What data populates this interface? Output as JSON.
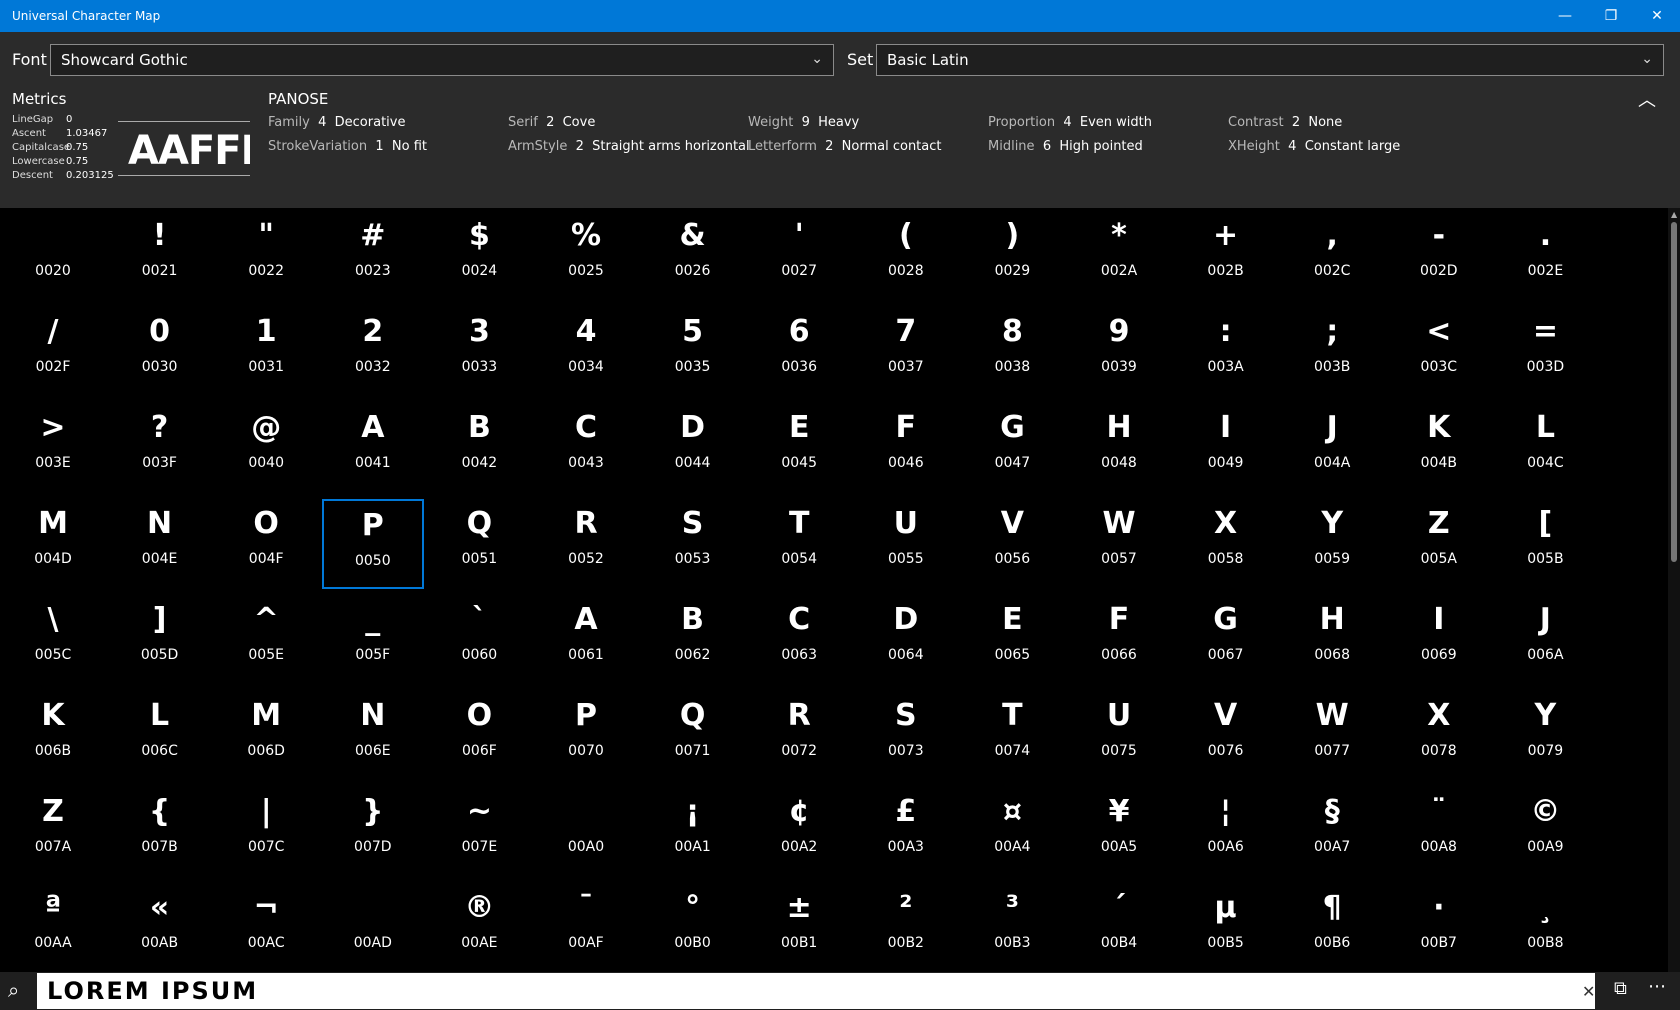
{
  "window": {
    "title": "Universal Character Map",
    "minimize_glyph": "—",
    "maximize_glyph": "❐",
    "close_glyph": "✕"
  },
  "font_bar": {
    "font_label": "Font",
    "font_value": "Showcard Gothic",
    "set_label": "Set",
    "set_value": "Basic Latin",
    "chevron": "⌄"
  },
  "metrics": {
    "title": "Metrics",
    "rows": [
      {
        "key": "LineGap",
        "value": "0"
      },
      {
        "key": "Ascent",
        "value": "1.03467"
      },
      {
        "key": "Capitalcase",
        "value": "0.75"
      },
      {
        "key": "Lowercase",
        "value": "0.75"
      },
      {
        "key": "Descent",
        "value": "0.203125"
      }
    ],
    "preview_text": "AAFFI"
  },
  "panose": {
    "title": "PANOSE",
    "items": [
      {
        "key": "Family",
        "num": "4",
        "value": "Decorative"
      },
      {
        "key": "Serif",
        "num": "2",
        "value": "Cove"
      },
      {
        "key": "Weight",
        "num": "9",
        "value": "Heavy"
      },
      {
        "key": "Proportion",
        "num": "4",
        "value": "Even width"
      },
      {
        "key": "Contrast",
        "num": "2",
        "value": "None"
      },
      {
        "key": "StrokeVariation",
        "num": "1",
        "value": "No fit"
      },
      {
        "key": "ArmStyle",
        "num": "2",
        "value": "Straight arms horizontal"
      },
      {
        "key": "Letterform",
        "num": "2",
        "value": "Normal contact"
      },
      {
        "key": "Midline",
        "num": "6",
        "value": "High pointed"
      },
      {
        "key": "XHeight",
        "num": "4",
        "value": "Constant large"
      }
    ],
    "collapse_glyph": "︿"
  },
  "grid": {
    "selected_code": "0050",
    "cells": [
      {
        "glyph": " ",
        "code": "0020"
      },
      {
        "glyph": "!",
        "code": "0021"
      },
      {
        "glyph": "\"",
        "code": "0022"
      },
      {
        "glyph": "#",
        "code": "0023"
      },
      {
        "glyph": "$",
        "code": "0024"
      },
      {
        "glyph": "%",
        "code": "0025"
      },
      {
        "glyph": "&",
        "code": "0026"
      },
      {
        "glyph": "'",
        "code": "0027"
      },
      {
        "glyph": "(",
        "code": "0028"
      },
      {
        "glyph": ")",
        "code": "0029"
      },
      {
        "glyph": "*",
        "code": "002A"
      },
      {
        "glyph": "+",
        "code": "002B"
      },
      {
        "glyph": ",",
        "code": "002C"
      },
      {
        "glyph": "-",
        "code": "002D"
      },
      {
        "glyph": ".",
        "code": "002E"
      },
      {
        "glyph": "/",
        "code": "002F"
      },
      {
        "glyph": "0",
        "code": "0030"
      },
      {
        "glyph": "1",
        "code": "0031"
      },
      {
        "glyph": "2",
        "code": "0032"
      },
      {
        "glyph": "3",
        "code": "0033"
      },
      {
        "glyph": "4",
        "code": "0034"
      },
      {
        "glyph": "5",
        "code": "0035"
      },
      {
        "glyph": "6",
        "code": "0036"
      },
      {
        "glyph": "7",
        "code": "0037"
      },
      {
        "glyph": "8",
        "code": "0038"
      },
      {
        "glyph": "9",
        "code": "0039"
      },
      {
        "glyph": ":",
        "code": "003A"
      },
      {
        "glyph": ";",
        "code": "003B"
      },
      {
        "glyph": "<",
        "code": "003C"
      },
      {
        "glyph": "=",
        "code": "003D"
      },
      {
        "glyph": ">",
        "code": "003E"
      },
      {
        "glyph": "?",
        "code": "003F"
      },
      {
        "glyph": "@",
        "code": "0040"
      },
      {
        "glyph": "A",
        "code": "0041"
      },
      {
        "glyph": "B",
        "code": "0042"
      },
      {
        "glyph": "C",
        "code": "0043"
      },
      {
        "glyph": "D",
        "code": "0044"
      },
      {
        "glyph": "E",
        "code": "0045"
      },
      {
        "glyph": "F",
        "code": "0046"
      },
      {
        "glyph": "G",
        "code": "0047"
      },
      {
        "glyph": "H",
        "code": "0048"
      },
      {
        "glyph": "I",
        "code": "0049"
      },
      {
        "glyph": "J",
        "code": "004A"
      },
      {
        "glyph": "K",
        "code": "004B"
      },
      {
        "glyph": "L",
        "code": "004C"
      },
      {
        "glyph": "M",
        "code": "004D"
      },
      {
        "glyph": "N",
        "code": "004E"
      },
      {
        "glyph": "O",
        "code": "004F"
      },
      {
        "glyph": "P",
        "code": "0050"
      },
      {
        "glyph": "Q",
        "code": "0051"
      },
      {
        "glyph": "R",
        "code": "0052"
      },
      {
        "glyph": "S",
        "code": "0053"
      },
      {
        "glyph": "T",
        "code": "0054"
      },
      {
        "glyph": "U",
        "code": "0055"
      },
      {
        "glyph": "V",
        "code": "0056"
      },
      {
        "glyph": "W",
        "code": "0057"
      },
      {
        "glyph": "X",
        "code": "0058"
      },
      {
        "glyph": "Y",
        "code": "0059"
      },
      {
        "glyph": "Z",
        "code": "005A"
      },
      {
        "glyph": "[",
        "code": "005B"
      },
      {
        "glyph": "\\",
        "code": "005C"
      },
      {
        "glyph": "]",
        "code": "005D"
      },
      {
        "glyph": "^",
        "code": "005E"
      },
      {
        "glyph": "_",
        "code": "005F"
      },
      {
        "glyph": "`",
        "code": "0060"
      },
      {
        "glyph": "A",
        "code": "0061"
      },
      {
        "glyph": "B",
        "code": "0062"
      },
      {
        "glyph": "C",
        "code": "0063"
      },
      {
        "glyph": "D",
        "code": "0064"
      },
      {
        "glyph": "E",
        "code": "0065"
      },
      {
        "glyph": "F",
        "code": "0066"
      },
      {
        "glyph": "G",
        "code": "0067"
      },
      {
        "glyph": "H",
        "code": "0068"
      },
      {
        "glyph": "I",
        "code": "0069"
      },
      {
        "glyph": "J",
        "code": "006A"
      },
      {
        "glyph": "K",
        "code": "006B"
      },
      {
        "glyph": "L",
        "code": "006C"
      },
      {
        "glyph": "M",
        "code": "006D"
      },
      {
        "glyph": "N",
        "code": "006E"
      },
      {
        "glyph": "O",
        "code": "006F"
      },
      {
        "glyph": "P",
        "code": "0070"
      },
      {
        "glyph": "Q",
        "code": "0071"
      },
      {
        "glyph": "R",
        "code": "0072"
      },
      {
        "glyph": "S",
        "code": "0073"
      },
      {
        "glyph": "T",
        "code": "0074"
      },
      {
        "glyph": "U",
        "code": "0075"
      },
      {
        "glyph": "V",
        "code": "0076"
      },
      {
        "glyph": "W",
        "code": "0077"
      },
      {
        "glyph": "X",
        "code": "0078"
      },
      {
        "glyph": "Y",
        "code": "0079"
      },
      {
        "glyph": "Z",
        "code": "007A"
      },
      {
        "glyph": "{",
        "code": "007B"
      },
      {
        "glyph": "|",
        "code": "007C"
      },
      {
        "glyph": "}",
        "code": "007D"
      },
      {
        "glyph": "~",
        "code": "007E"
      },
      {
        "glyph": " ",
        "code": "00A0"
      },
      {
        "glyph": "¡",
        "code": "00A1"
      },
      {
        "glyph": "¢",
        "code": "00A2"
      },
      {
        "glyph": "£",
        "code": "00A3"
      },
      {
        "glyph": "¤",
        "code": "00A4"
      },
      {
        "glyph": "¥",
        "code": "00A5"
      },
      {
        "glyph": "¦",
        "code": "00A6"
      },
      {
        "glyph": "§",
        "code": "00A7"
      },
      {
        "glyph": "¨",
        "code": "00A8"
      },
      {
        "glyph": "©",
        "code": "00A9"
      },
      {
        "glyph": "ª",
        "code": "00AA"
      },
      {
        "glyph": "«",
        "code": "00AB"
      },
      {
        "glyph": "¬",
        "code": "00AC"
      },
      {
        "glyph": " ",
        "code": "00AD"
      },
      {
        "glyph": "®",
        "code": "00AE"
      },
      {
        "glyph": "¯",
        "code": "00AF"
      },
      {
        "glyph": "°",
        "code": "00B0"
      },
      {
        "glyph": "±",
        "code": "00B1"
      },
      {
        "glyph": "²",
        "code": "00B2"
      },
      {
        "glyph": "³",
        "code": "00B3"
      },
      {
        "glyph": "´",
        "code": "00B4"
      },
      {
        "glyph": "µ",
        "code": "00B5"
      },
      {
        "glyph": "¶",
        "code": "00B6"
      },
      {
        "glyph": "·",
        "code": "00B7"
      },
      {
        "glyph": "¸",
        "code": "00B8"
      }
    ]
  },
  "bottom_bar": {
    "search_value": "LOREM IPSUM",
    "search_glyph": "⌕",
    "clear_glyph": "✕",
    "copy_glyph": "⧉",
    "more_glyph": "⋯"
  },
  "colors": {
    "accent": "#0078d7",
    "panel_bg": "#2b2b2b",
    "grid_bg": "#000000"
  }
}
